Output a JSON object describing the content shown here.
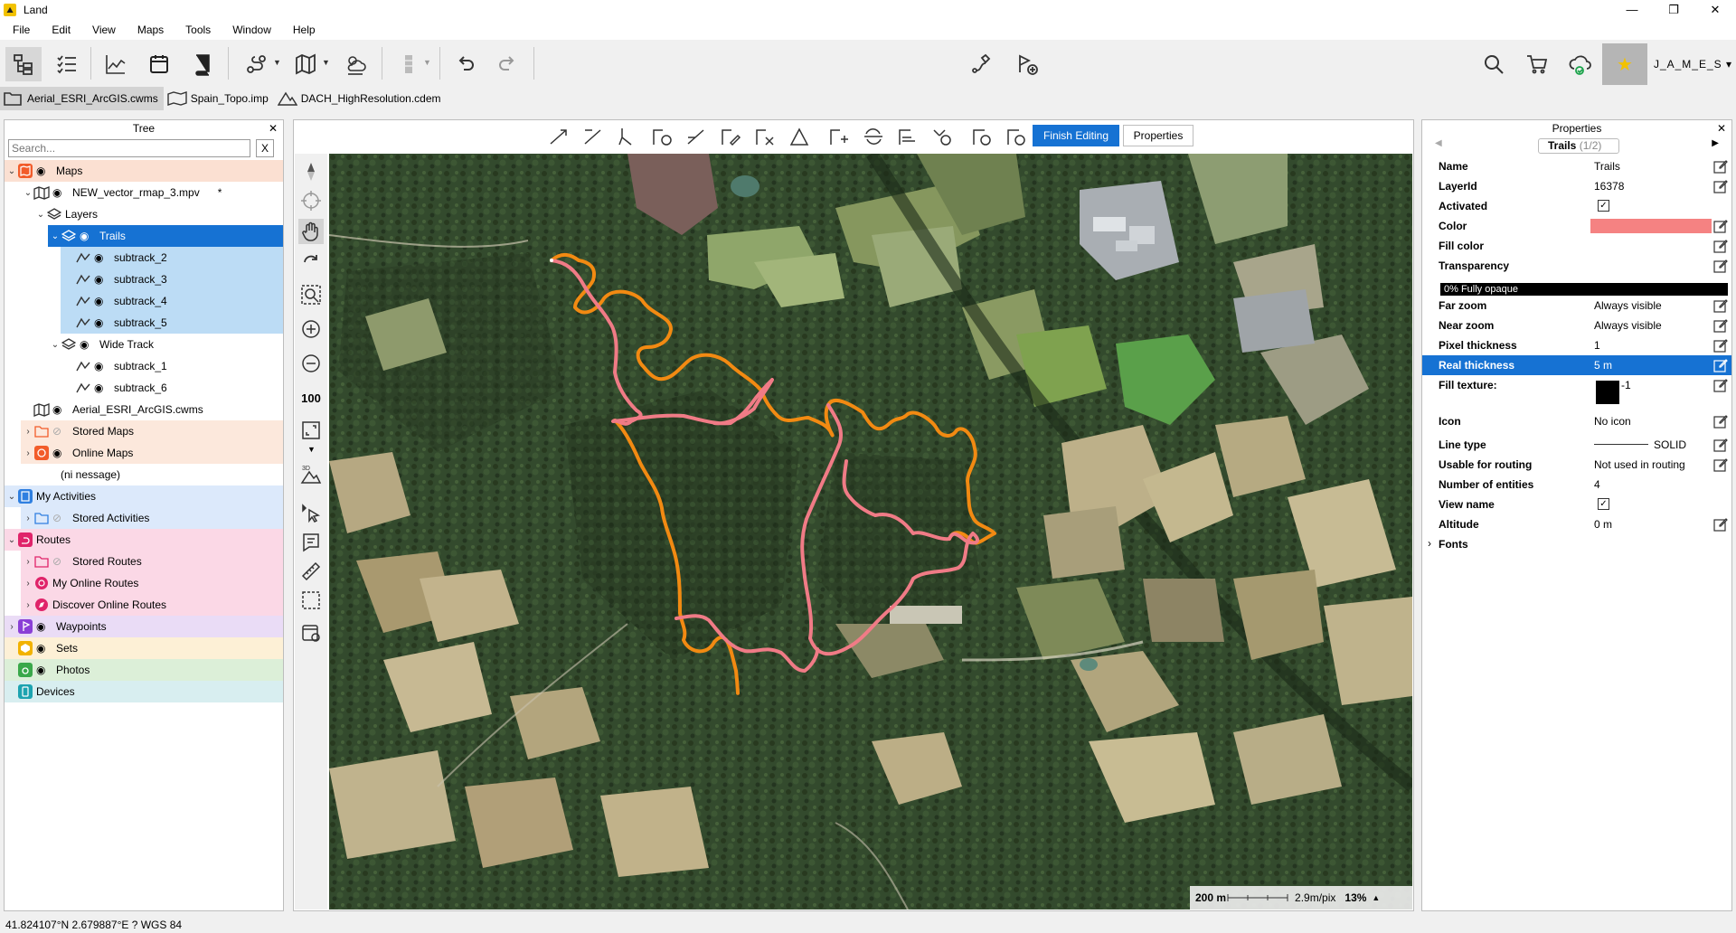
{
  "app": {
    "title": "Land"
  },
  "window_controls": {
    "minimize": "—",
    "maximize": "❐",
    "close": "✕"
  },
  "menu": [
    "File",
    "Edit",
    "View",
    "Maps",
    "Tools",
    "Window",
    "Help"
  ],
  "user": {
    "name": "J_A_M_E_S ▾"
  },
  "file_tabs": [
    "Aerial_ESRI_ArcGIS.cwms",
    "Spain_Topo.imp",
    "DACH_HighResolution.cdem"
  ],
  "tree": {
    "title": "Tree",
    "close": "✕",
    "search_placeholder": "Search...",
    "search_clear": "X",
    "rows": [
      {
        "label": "Maps"
      },
      {
        "label": "NEW_vector_rmap_3.mpv",
        "suffix": "*"
      },
      {
        "label": "Layers"
      },
      {
        "label": "Trails"
      },
      {
        "label": "subtrack_2"
      },
      {
        "label": "subtrack_3"
      },
      {
        "label": "subtrack_4"
      },
      {
        "label": "subtrack_5"
      },
      {
        "label": "Wide Track"
      },
      {
        "label": "subtrack_1"
      },
      {
        "label": "subtrack_6"
      },
      {
        "label": "Aerial_ESRI_ArcGIS.cwms"
      },
      {
        "label": "Stored Maps"
      },
      {
        "label": "Online Maps"
      },
      {
        "label": "(ni nessage)"
      },
      {
        "label": "My Activities"
      },
      {
        "label": "Stored Activities"
      },
      {
        "label": "Routes"
      },
      {
        "label": "Stored Routes"
      },
      {
        "label": "My Online Routes"
      },
      {
        "label": "Discover Online Routes"
      },
      {
        "label": "Waypoints"
      },
      {
        "label": "Sets"
      },
      {
        "label": "Photos"
      },
      {
        "label": "Devices"
      }
    ]
  },
  "edit_toolbar": {
    "finish": "Finish Editing",
    "properties": "Properties"
  },
  "map": {
    "scale_label": "200 m",
    "resolution": "2.9m/pix",
    "zoom": "13%",
    "track_colors": {
      "orange": "#f28a12",
      "pink": "#f07b86"
    }
  },
  "properties": {
    "title": "Properties",
    "close": "✕",
    "layer_name": "Trails",
    "layer_index": "(1/2)",
    "rows": {
      "name": {
        "k": "Name",
        "v": "Trails"
      },
      "layerid": {
        "k": "LayerId",
        "v": "16378"
      },
      "activated": {
        "k": "Activated",
        "v": "✓"
      },
      "color": {
        "k": "Color",
        "v": "#f58282"
      },
      "fillcolor": {
        "k": "Fill color",
        "v": "#ffffff"
      },
      "transparency": {
        "k": "Transparency",
        "v": "0% Fully opaque"
      },
      "farzoom": {
        "k": "Far zoom",
        "v": "Always visible"
      },
      "nearzoom": {
        "k": "Near zoom",
        "v": "Always visible"
      },
      "pixthick": {
        "k": "Pixel thickness",
        "v": "1"
      },
      "realthick": {
        "k": "Real thickness",
        "v": "5 m"
      },
      "filltex": {
        "k": "Fill texture:",
        "v": "-1"
      },
      "icon": {
        "k": "Icon",
        "v": "No icon"
      },
      "linetype": {
        "k": "Line type",
        "v": "SOLID"
      },
      "routing": {
        "k": "Usable for routing",
        "v": "Not used in routing"
      },
      "entities": {
        "k": "Number of entities",
        "v": "4"
      },
      "viewname": {
        "k": "View name",
        "v": "✓"
      },
      "altitude": {
        "k": "Altitude",
        "v": "0 m"
      },
      "fonts": {
        "k": "Fonts",
        "v": ""
      }
    }
  },
  "status": {
    "coords": "41.824107°N 2.679887°E  ?  WGS 84"
  }
}
